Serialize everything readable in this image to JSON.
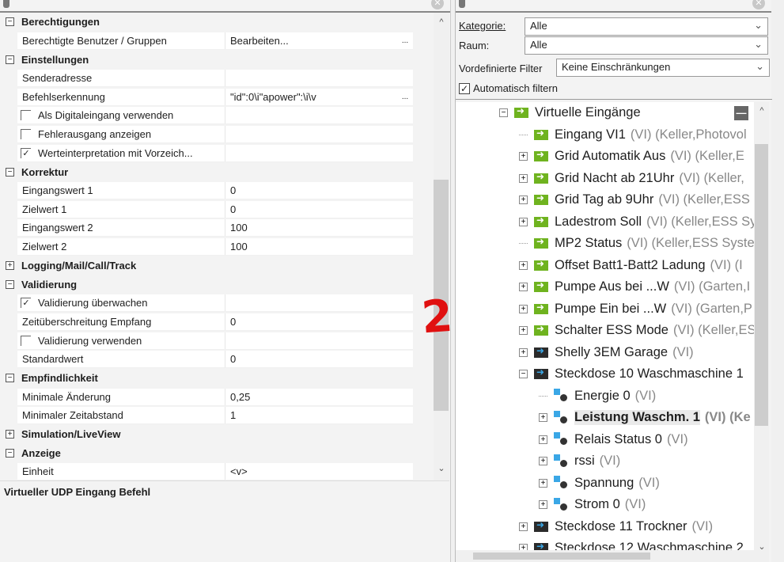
{
  "properties": [
    {
      "type": "cat",
      "label": "Berechtigungen",
      "expanded": true
    },
    {
      "type": "prop",
      "name": "Berechtigte Benutzer / Gruppen",
      "value": "Bearbeiten...",
      "ellipsis": "..."
    },
    {
      "type": "cat",
      "label": "Einstellungen",
      "expanded": true
    },
    {
      "type": "prop",
      "name": "Senderadresse",
      "value": ""
    },
    {
      "type": "prop",
      "name": "Befehlserkennung",
      "value": "\"id\":0\\i\"apower\":\\i\\v",
      "ellipsis": "..."
    },
    {
      "type": "check",
      "name": "Als Digitaleingang verwenden",
      "checked": false
    },
    {
      "type": "check",
      "name": "Fehlerausgang anzeigen",
      "checked": false
    },
    {
      "type": "check",
      "name": "Werteinterpretation mit Vorzeich...",
      "checked": true
    },
    {
      "type": "cat",
      "label": "Korrektur",
      "expanded": true
    },
    {
      "type": "prop",
      "name": "Eingangswert 1",
      "value": "0"
    },
    {
      "type": "prop",
      "name": "Zielwert 1",
      "value": "0"
    },
    {
      "type": "prop",
      "name": "Eingangswert 2",
      "value": "100"
    },
    {
      "type": "prop",
      "name": "Zielwert 2",
      "value": "100"
    },
    {
      "type": "cat",
      "label": "Logging/Mail/Call/Track",
      "expanded": false
    },
    {
      "type": "cat",
      "label": "Validierung",
      "expanded": true
    },
    {
      "type": "check",
      "name": "Validierung überwachen",
      "checked": true
    },
    {
      "type": "prop",
      "name": "Zeitüberschreitung Empfang",
      "value": "0"
    },
    {
      "type": "check",
      "name": "Validierung verwenden",
      "checked": false
    },
    {
      "type": "prop",
      "name": "Standardwert",
      "value": "0"
    },
    {
      "type": "cat",
      "label": "Empfindlichkeit",
      "expanded": true
    },
    {
      "type": "prop",
      "name": "Minimale Änderung",
      "value": "0,25"
    },
    {
      "type": "prop",
      "name": "Minimaler Zeitabstand",
      "value": "1"
    },
    {
      "type": "cat",
      "label": "Simulation/LiveView",
      "expanded": false
    },
    {
      "type": "cat",
      "label": "Anzeige",
      "expanded": true
    },
    {
      "type": "prop",
      "name": "Einheit",
      "value": "<v>"
    }
  ],
  "description": "Virtueller UDP Eingang Befehl",
  "filter": {
    "kategorie_label": "Kategorie:",
    "kategorie_value": "Alle",
    "raum_label": "Raum:",
    "raum_value": "Alle",
    "vordef_label": "Vordefinierte Filter",
    "vordef_value": "Keine Einschränkungen",
    "auto_label": "Automatisch filtern",
    "auto_checked": true
  },
  "tree": [
    {
      "level": 0,
      "toggle": "-",
      "icon": "green",
      "label": "Virtuelle Eingänge",
      "extra": ""
    },
    {
      "level": 1,
      "toggle": "",
      "icon": "green",
      "label": "Eingang VI1",
      "extra": "(VI) (Keller,Photovol"
    },
    {
      "level": 1,
      "toggle": "+",
      "icon": "green",
      "label": "Grid Automatik Aus",
      "extra": "(VI) (Keller,E"
    },
    {
      "level": 1,
      "toggle": "+",
      "icon": "green",
      "label": "Grid Nacht ab 21Uhr",
      "extra": "(VI) (Keller,"
    },
    {
      "level": 1,
      "toggle": "+",
      "icon": "green",
      "label": "Grid Tag ab 9Uhr",
      "extra": "(VI) (Keller,ESS"
    },
    {
      "level": 1,
      "toggle": "+",
      "icon": "green",
      "label": "Ladestrom Soll",
      "extra": "(VI) (Keller,ESS Sy"
    },
    {
      "level": 1,
      "toggle": "",
      "icon": "green",
      "label": "MP2 Status",
      "extra": "(VI) (Keller,ESS Syste"
    },
    {
      "level": 1,
      "toggle": "+",
      "icon": "green",
      "label": "Offset Batt1-Batt2 Ladung",
      "extra": "(VI) (I"
    },
    {
      "level": 1,
      "toggle": "+",
      "icon": "green",
      "label": "Pumpe Aus bei ...W",
      "extra": "(VI) (Garten,I"
    },
    {
      "level": 1,
      "toggle": "+",
      "icon": "green",
      "label": "Pumpe Ein bei ...W",
      "extra": "(VI) (Garten,P"
    },
    {
      "level": 1,
      "toggle": "+",
      "icon": "green",
      "label": "Schalter ESS Mode",
      "extra": "(VI) (Keller,ES"
    },
    {
      "level": 1,
      "toggle": "+",
      "icon": "dark",
      "label": "Shelly 3EM Garage",
      "extra": "(VI)"
    },
    {
      "level": 1,
      "toggle": "-",
      "icon": "dark",
      "label": "Steckdose 10 Waschmaschine 1",
      "extra": ""
    },
    {
      "level": 2,
      "toggle": "",
      "icon": "sub",
      "label": "Energie 0",
      "extra": "(VI)"
    },
    {
      "level": 2,
      "toggle": "+",
      "icon": "sub",
      "label": "Leistung Waschm. 1",
      "extra": "(VI) (Ke",
      "selected": true
    },
    {
      "level": 2,
      "toggle": "+",
      "icon": "sub",
      "label": "Relais Status 0",
      "extra": "(VI)"
    },
    {
      "level": 2,
      "toggle": "+",
      "icon": "sub",
      "label": "rssi",
      "extra": "(VI)"
    },
    {
      "level": 2,
      "toggle": "+",
      "icon": "sub",
      "label": "Spannung",
      "extra": "(VI)"
    },
    {
      "level": 2,
      "toggle": "+",
      "icon": "sub",
      "label": "Strom 0",
      "extra": "(VI)"
    },
    {
      "level": 1,
      "toggle": "+",
      "icon": "dark",
      "label": "Steckdose 11 Trockner",
      "extra": "(VI)"
    },
    {
      "level": 1,
      "toggle": "+",
      "icon": "dark",
      "label": "Steckdose 12 Waschmaschine 2",
      "extra": ""
    }
  ],
  "annotation": "2"
}
